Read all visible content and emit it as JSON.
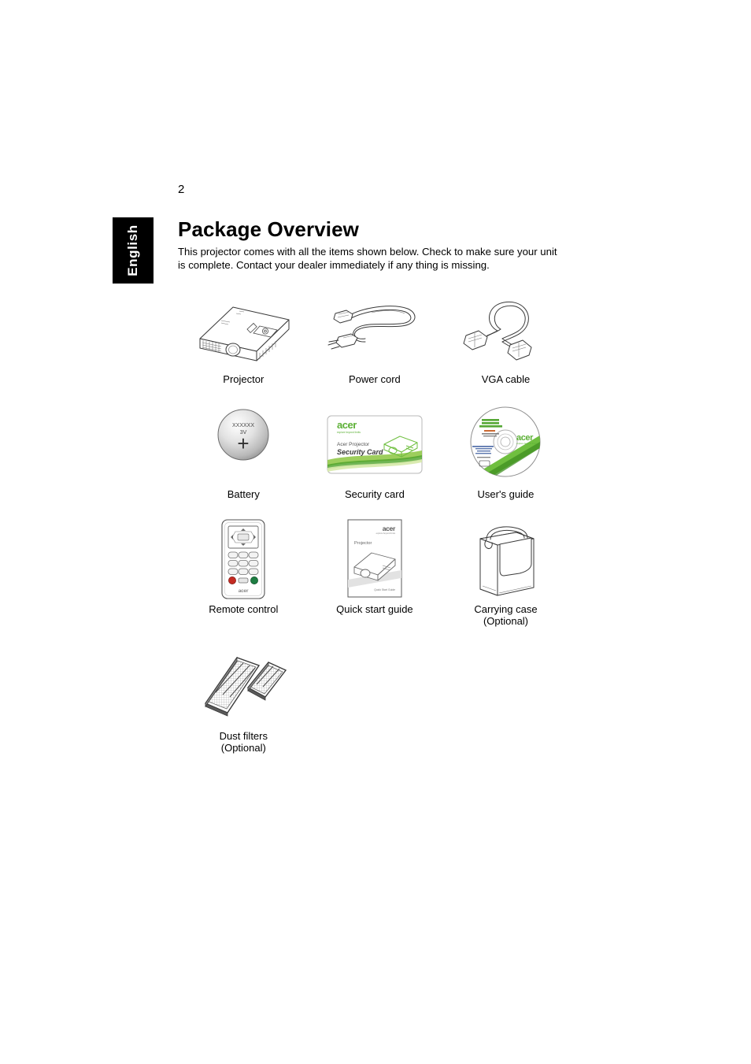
{
  "page": {
    "number": "2",
    "language_tab": "English"
  },
  "section": {
    "title": "Package Overview",
    "intro": "This projector comes with all the items shown below. Check to make sure your unit is complete. Contact your dealer immediately if any thing is missing."
  },
  "brand": {
    "name": "acer",
    "tagline": "explore beyond limits",
    "green": "#5cb036",
    "dark_green": "#2f7d1e"
  },
  "items": [
    [
      {
        "label": "Projector",
        "icon": "projector-illustration"
      },
      {
        "label": "Power cord",
        "icon": "power-cord-illustration"
      },
      {
        "label": "VGA cable",
        "icon": "vga-cable-illustration"
      }
    ],
    [
      {
        "label": "Battery",
        "icon": "coin-battery-illustration",
        "battery": {
          "model": "XXXXXX",
          "voltage": "3V",
          "polarity": "+"
        }
      },
      {
        "label": "Security card",
        "icon": "security-card-illustration",
        "card": {
          "line1": "Acer Projector",
          "line2": "Security Card"
        }
      },
      {
        "label": "User's guide",
        "icon": "cd-disc-illustration"
      }
    ],
    [
      {
        "label": "Remote control",
        "icon": "remote-control-illustration"
      },
      {
        "label": "Quick start guide",
        "icon": "quick-start-guide-illustration",
        "booklet": {
          "subject": "Projector",
          "footer": "Quick Start Guide"
        }
      },
      {
        "label": "Carrying case\n(Optional)",
        "icon": "carrying-case-illustration"
      }
    ],
    [
      {
        "label": "Dust filters\n(Optional)",
        "icon": "dust-filters-illustration"
      }
    ]
  ]
}
